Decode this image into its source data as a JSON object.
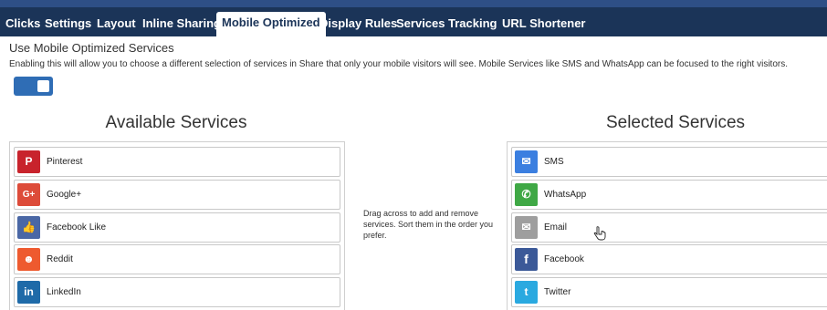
{
  "tabs": [
    {
      "label": "Clicks"
    },
    {
      "label": "Settings"
    },
    {
      "label": "Layout"
    },
    {
      "label": "Inline Sharing"
    },
    {
      "label": "Mobile Optimized"
    },
    {
      "label": "Display Rules"
    },
    {
      "label": "Services"
    },
    {
      "label": "Tracking"
    },
    {
      "label": "URL Shortener"
    }
  ],
  "active_tab": "Mobile Optimized",
  "setting": {
    "title": "Use Mobile Optimized Services",
    "description": "Enabling this will allow you to choose a different selection of services in Share that only your mobile visitors will see. Mobile Services like SMS and WhatsApp can be focused to the right visitors.",
    "toggle_on": true
  },
  "available": {
    "title": "Available Services",
    "items": [
      {
        "label": "Pinterest",
        "icon": "pinterest-icon",
        "color": "#c8232c",
        "glyph": "P"
      },
      {
        "label": "Google+",
        "icon": "google-plus-icon",
        "color": "#dd4b39",
        "glyph": "G+"
      },
      {
        "label": "Facebook Like",
        "icon": "thumbs-up-icon",
        "color": "#4a67a5",
        "glyph": "👍"
      },
      {
        "label": "Reddit",
        "icon": "reddit-icon",
        "color": "#ee5a2f",
        "glyph": "☻"
      },
      {
        "label": "LinkedIn",
        "icon": "linkedin-icon",
        "color": "#1e6aa8",
        "glyph": "in"
      }
    ]
  },
  "hint": "Drag across to add and remove services. Sort them in the order you prefer.",
  "selected": {
    "title": "Selected Services",
    "items": [
      {
        "label": "SMS",
        "icon": "sms-icon",
        "color": "#3b7fe0",
        "glyph": "✉"
      },
      {
        "label": "WhatsApp",
        "icon": "whatsapp-icon",
        "color": "#3fa845",
        "glyph": "✆"
      },
      {
        "label": "Email",
        "icon": "email-icon",
        "color": "#9e9e9e",
        "glyph": "✉"
      },
      {
        "label": "Facebook",
        "icon": "facebook-icon",
        "color": "#3b5998",
        "glyph": "f"
      },
      {
        "label": "Twitter",
        "icon": "twitter-icon",
        "color": "#2aa9e0",
        "glyph": "t"
      }
    ]
  }
}
